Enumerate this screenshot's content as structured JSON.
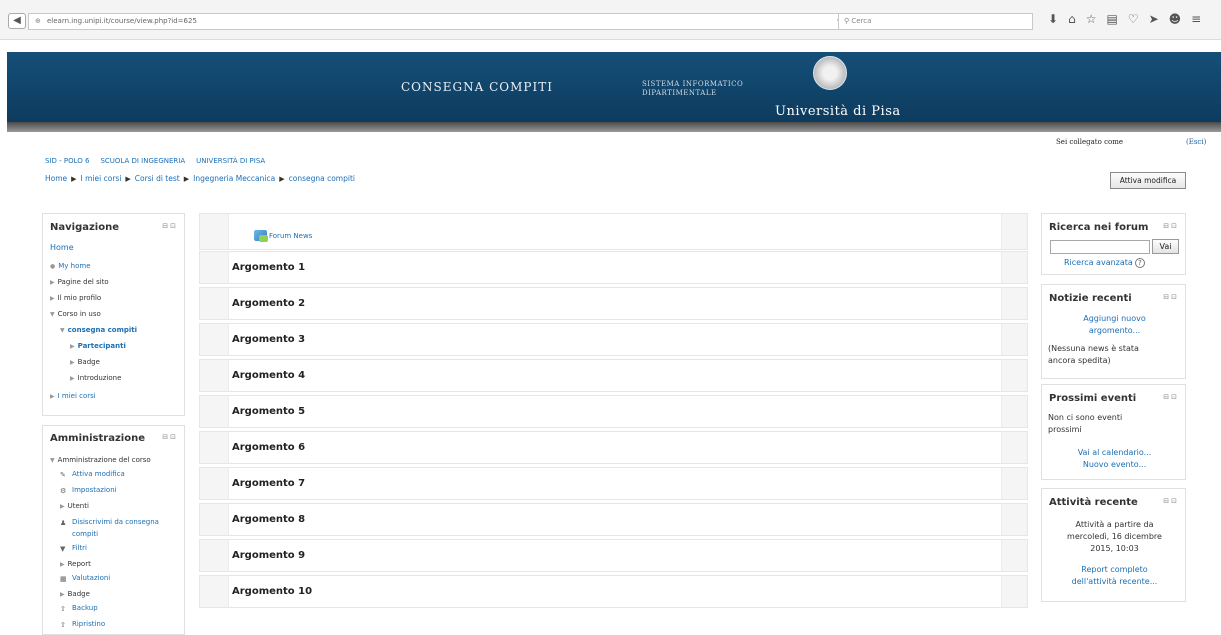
{
  "browser": {
    "url": "elearn.ing.unipi.it/course/view.php?id=625",
    "url_mark": "▽",
    "reload_icon": "C",
    "search_placeholder": "Cerca",
    "back_icon": "back-arrow-icon"
  },
  "header": {
    "consegna": "CONSEGNA COMPITI",
    "sistema_line1": "SISTEMA INFORMATICO",
    "sistema_line2": "DIPARTIMENTALE",
    "university": "Università di Pisa"
  },
  "user": {
    "logged_as": "Sei collegato come",
    "logout": "(Esci)"
  },
  "toplinks": [
    "SID - POLO 6",
    "SCUOLA DI INGEGNERIA",
    "UNIVERSITÀ DI PISA"
  ],
  "breadcrumb": [
    "Home",
    "I miei corsi",
    "Corsi di test",
    "Ingegneria Meccanica",
    "consegna compiti"
  ],
  "edit_button": "Attiva modifica",
  "navigation": {
    "title": "Navigazione",
    "home": "Home",
    "items": {
      "my_home": "My home",
      "pagine": "Pagine del sito",
      "profilo": "Il mio profilo",
      "corso": "Corso in uso",
      "consegna": "consegna compiti",
      "partecipanti": "Partecipanti",
      "badge": "Badge",
      "introduzione": "Introduzione",
      "miei_corsi": "I miei corsi"
    }
  },
  "admin": {
    "title": "Amministrazione",
    "root": "Amministrazione del corso",
    "items": {
      "attiva": "Attiva modifica",
      "impostazioni": "Impostazioni",
      "utenti": "Utenti",
      "disiscrivimi1": "Disiscrivimi da consegna",
      "disiscrivimi2": "compiti",
      "filtri": "Filtri",
      "report": "Report",
      "valutazioni": "Valutazioni",
      "badge": "Badge",
      "backup": "Backup",
      "ripristino": "Ripristino"
    }
  },
  "course": {
    "forum": "Forum News",
    "sections": [
      "Argomento 1",
      "Argomento 2",
      "Argomento 3",
      "Argomento 4",
      "Argomento 5",
      "Argomento 6",
      "Argomento 7",
      "Argomento 8",
      "Argomento 9",
      "Argomento 10"
    ]
  },
  "search_forum": {
    "title": "Ricerca nei forum",
    "button": "Vai",
    "advanced": "Ricerca avanzata"
  },
  "news": {
    "title": "Notizie recenti",
    "add1": "Aggiungi nuovo",
    "add2": "argomento...",
    "none1": "(Nessuna news è stata",
    "none2": "ancora spedita)"
  },
  "events": {
    "title": "Prossimi eventi",
    "none1": "Non ci sono eventi",
    "none2": "prossimi",
    "calendar": "Vai al calendario...",
    "new": "Nuovo evento..."
  },
  "activity": {
    "title": "Attività recente",
    "since1": "Attività a partire da",
    "since2": "mercoledì, 16 dicembre",
    "since3": "2015, 10:03",
    "report1": "Report completo",
    "report2": "dell'attività recente..."
  }
}
